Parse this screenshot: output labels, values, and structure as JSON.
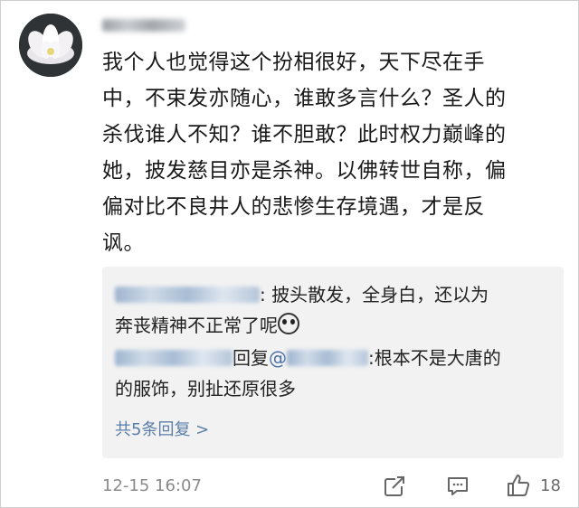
{
  "comment": {
    "author_masked": "████████",
    "lines": [
      "我个人也觉得这个扮相很好，天下尽在手",
      "中，不束发亦随心，谁敢多言什么？圣人的",
      "杀伐谁人不知？谁不胆敢？此时权力巅峰的",
      "她，披发慈目亦是杀神。以佛转世自称，偏",
      "偏对比不良井人的悲惨生存境遇，才是反",
      "讽。"
    ]
  },
  "replies": [
    {
      "text_line1": ": 披头散发，全身白，还以为",
      "text_line2": "奔丧精神不正常了呢"
    },
    {
      "reply_word": "回复",
      "mention_at": "@",
      "text_line1": ":根本不是大唐的",
      "text_line2": "的服饰，别扯还原很多"
    }
  ],
  "more_replies": "共5条回复 >",
  "footer": {
    "timestamp": "12-15 16:07",
    "like_count": "18"
  },
  "icons": {
    "avatar": "lotus-avatar",
    "share": "share-icon",
    "comment": "comment-icon",
    "like": "thumbs-up-icon",
    "emoji": "shocked-face-emoji"
  }
}
